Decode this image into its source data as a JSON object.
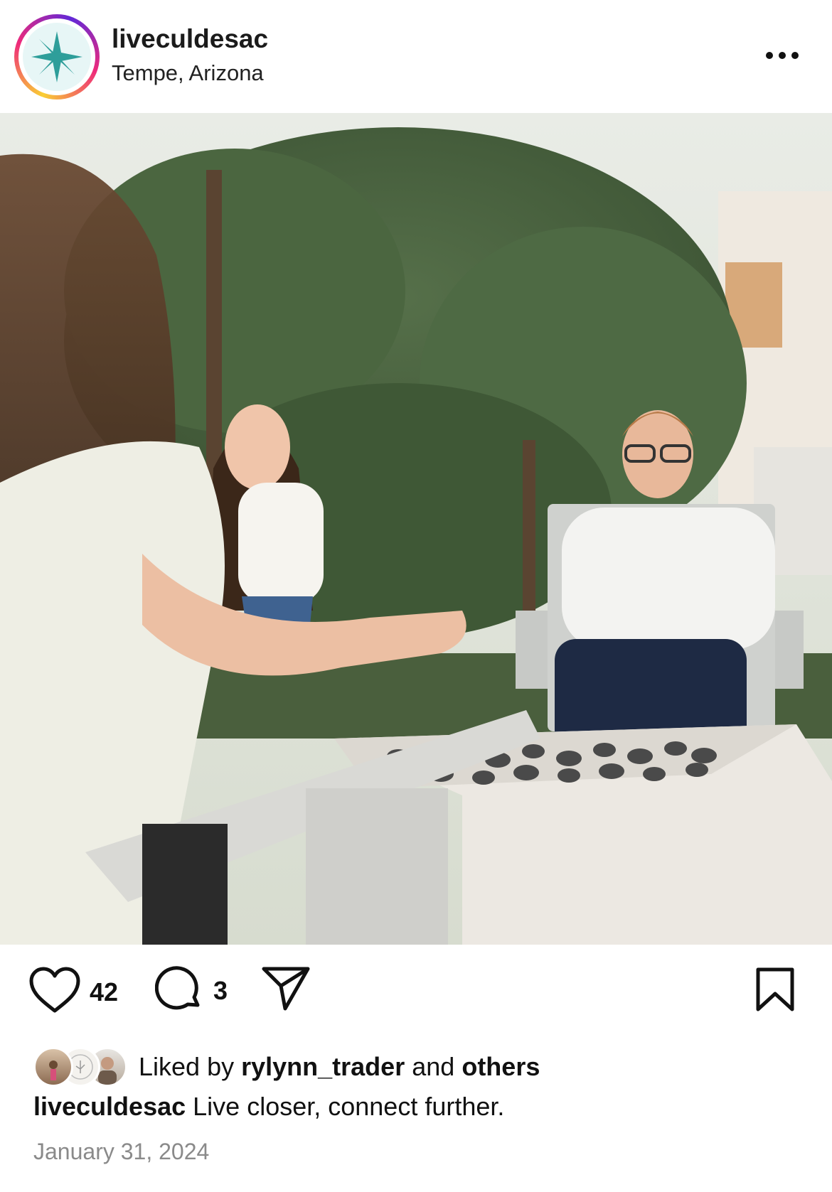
{
  "post": {
    "username": "liveculdesac",
    "location": "Tempe, Arizona",
    "like_count": "42",
    "comment_count": "3",
    "liked_by_prefix": "Liked by",
    "liked_by_user": "rylynn_trader",
    "liked_by_and": "and",
    "liked_by_others": "others",
    "caption_user": "liveculdesac",
    "caption_text": "Live closer, connect further.",
    "date": "January 31, 2024"
  },
  "icons": {
    "more": "more-options-icon",
    "like": "heart-icon",
    "comment": "comment-icon",
    "share": "send-icon",
    "save": "bookmark-icon",
    "brand": "compass-star-icon"
  },
  "colors": {
    "brand_teal": "#2e9e9a",
    "story_ring": [
      "#f9ce34",
      "#ee2a7b",
      "#6228d7"
    ]
  }
}
